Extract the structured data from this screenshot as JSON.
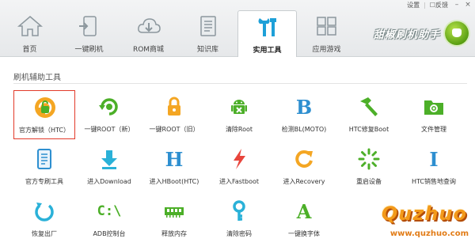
{
  "window_controls": {
    "settings": "设置",
    "feedback": "反馈",
    "minimize": "–",
    "close": "×"
  },
  "tabs": [
    {
      "label": "首页",
      "icon": "home-icon"
    },
    {
      "label": "一键刷机",
      "icon": "phone-flash-icon"
    },
    {
      "label": "ROM商城",
      "icon": "cloud-download-icon"
    },
    {
      "label": "知识库",
      "icon": "document-icon"
    },
    {
      "label": "实用工具",
      "icon": "tools-icon",
      "active": true
    },
    {
      "label": "应用游戏",
      "icon": "apps-icon"
    }
  ],
  "brand": {
    "title": "甜椒刷机助手"
  },
  "section": {
    "title": "刷机辅助工具"
  },
  "tools": [
    {
      "label": "官方解锁（HTC）",
      "icon": "unlock-icon",
      "selected": true
    },
    {
      "label": "一键ROOT（新）",
      "icon": "root-refresh-icon"
    },
    {
      "label": "一键ROOT（旧）",
      "icon": "lock-icon"
    },
    {
      "label": "清除Root",
      "icon": "android-icon"
    },
    {
      "label": "检测BL(MOTO)",
      "icon": "letter-b-icon",
      "glyph": "B"
    },
    {
      "label": "HTC修复Boot",
      "icon": "hammer-icon"
    },
    {
      "label": "文件管理",
      "icon": "folder-icon"
    },
    {
      "label": "官方专刷工具",
      "icon": "official-tool-icon"
    },
    {
      "label": "进入Download",
      "icon": "download-icon"
    },
    {
      "label": "进入HBoot(HTC)",
      "icon": "letter-h-icon",
      "glyph": "H"
    },
    {
      "label": "进入Fastboot",
      "icon": "lightning-icon"
    },
    {
      "label": "进入Recovery",
      "icon": "recovery-icon"
    },
    {
      "label": "重启设备",
      "icon": "restart-icon"
    },
    {
      "label": "HTC销售地查询",
      "icon": "letter-i-icon",
      "glyph": "I"
    },
    {
      "label": "恢复出厂",
      "icon": "restore-icon"
    },
    {
      "label": "ADB控制台",
      "icon": "console-icon",
      "glyph": "C:\\"
    },
    {
      "label": "释放内存",
      "icon": "memory-icon"
    },
    {
      "label": "清除密码",
      "icon": "key-icon"
    },
    {
      "label": "一键换字体",
      "icon": "letter-a-icon",
      "glyph": "A"
    }
  ],
  "watermark": {
    "big": "Quzhuo",
    "small": "www.quzhuo.com"
  },
  "colors": {
    "accent_green": "#5aa012",
    "selected_border": "#e23a2a",
    "watermark_orange": "#f39a1a"
  }
}
